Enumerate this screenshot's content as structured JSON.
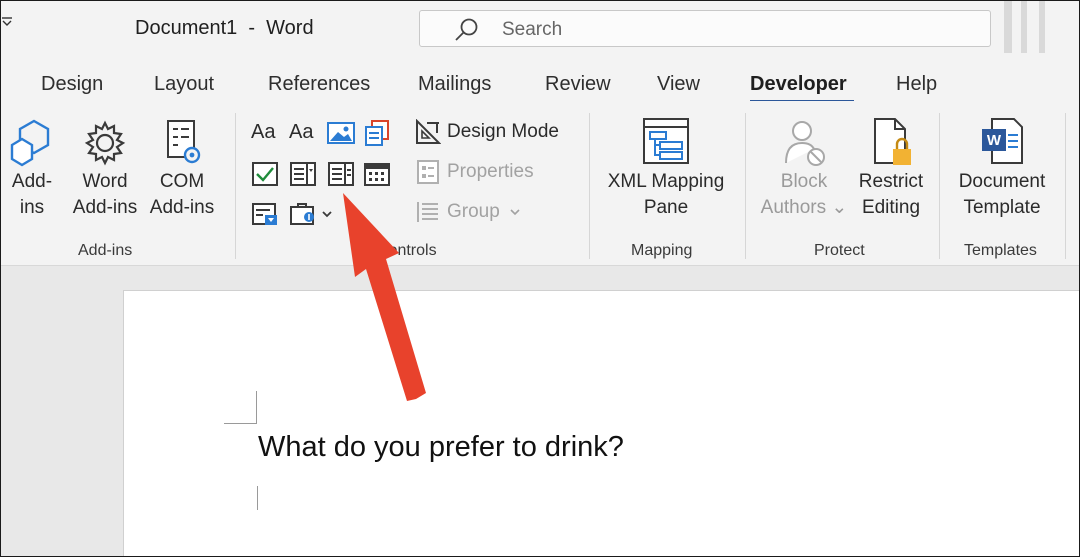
{
  "title_bar": {
    "document_name": "Document1  -  Word",
    "search_placeholder": "Search",
    "qat_icon": "chevron-down-icon"
  },
  "tabs": [
    {
      "label": "Design"
    },
    {
      "label": "Layout"
    },
    {
      "label": "References"
    },
    {
      "label": "Mailings"
    },
    {
      "label": "Review"
    },
    {
      "label": "View"
    },
    {
      "label": "Developer",
      "active": true
    },
    {
      "label": "Help"
    }
  ],
  "ribbon": {
    "addins": {
      "group_label": "Add-ins",
      "addins_btn": {
        "line1": "Add-",
        "line2": "ins",
        "icon": "hexagon-addins-icon"
      },
      "word_addins_btn": {
        "line1": "Word",
        "line2": "Add-ins",
        "icon": "gear-icon"
      },
      "com_addins_btn": {
        "line1": "COM",
        "line2": "Add-ins",
        "icon": "com-addins-icon"
      }
    },
    "controls": {
      "group_label": "Controls",
      "rich_text_label": "Aa",
      "plain_text_label": "Aa",
      "design_mode_label": "Design Mode",
      "properties_label": "Properties",
      "group_btn_label": "Group"
    },
    "mapping": {
      "group_label": "Mapping",
      "xml_btn": {
        "line1": "XML Mapping",
        "line2": "Pane",
        "icon": "xml-mapping-icon"
      }
    },
    "protect": {
      "group_label": "Protect",
      "block_authors": {
        "line1": "Block",
        "line2": "Authors",
        "icon": "block-authors-icon"
      },
      "restrict_editing": {
        "line1": "Restrict",
        "line2": "Editing",
        "icon": "lock-document-icon"
      }
    },
    "templates": {
      "group_label": "Templates",
      "doc_template": {
        "line1": "Document",
        "line2": "Template",
        "icon": "word-document-icon"
      }
    }
  },
  "document": {
    "question_text": "What do you prefer to drink?"
  },
  "colors": {
    "accent": "#2b579a",
    "arrow": "#e8422c",
    "ribbon_bg": "#f3f3f3"
  }
}
